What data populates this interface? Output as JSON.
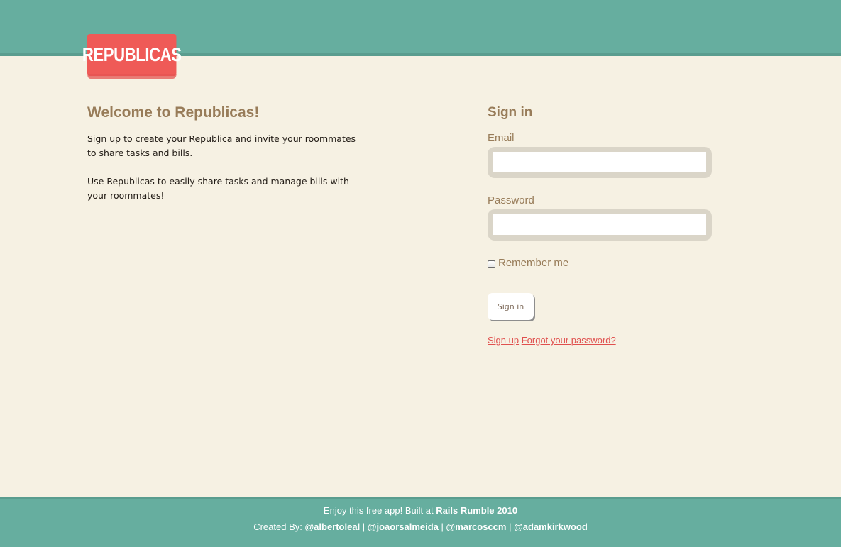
{
  "header": {
    "logo_text": "REPUBLICAS"
  },
  "welcome": {
    "title": "Welcome to Republicas!",
    "paragraph1": "Sign up to create your Republica and invite your roommates to share tasks and bills.",
    "paragraph2": "Use Republicas to easily share tasks and manage bills with your roommates!"
  },
  "signin": {
    "title": "Sign in",
    "email_label": "Email",
    "email_value": "",
    "password_label": "Password",
    "password_value": "",
    "remember_label": "Remember me",
    "remember_checked": false,
    "button_label": "Sign in",
    "signup_link": "Sign up",
    "forgot_link": "Forgot your password?"
  },
  "footer": {
    "line1_prefix": "Enjoy this free app! Built at ",
    "line1_event": "Rails Rumble 2010",
    "line2_prefix": "Created By: ",
    "separator": " | ",
    "creators": [
      "@albertoleal",
      "@joaorsalmeida",
      "@marcosccm",
      "@adamkirkwood"
    ]
  },
  "colors": {
    "header_bg": "#66ae9f",
    "page_bg": "#f6f1e3",
    "logo_bg": "#ef5a57",
    "heading": "#987c59",
    "link": "#e0504e"
  }
}
